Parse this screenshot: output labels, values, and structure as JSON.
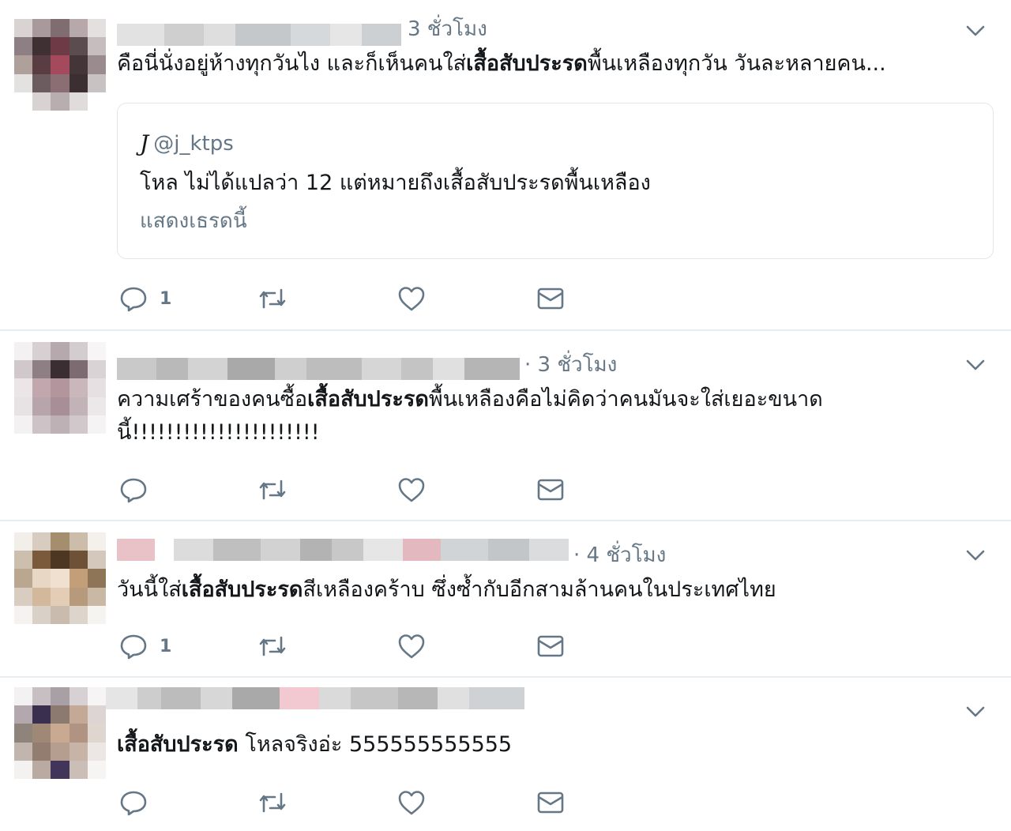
{
  "tweets": [
    {
      "timestamp": "3 ชั่วโมง",
      "text_before": "คือนี่นั่งอยู่ห้างทุกวันไง และก็เห็นคนใส่",
      "text_bold": "เสื้อสับประรด",
      "text_after": "พื้นเหลืองทุกวัน วันละหลายคน...",
      "quote": {
        "handle": "@j_ktps",
        "text": "โหล ไม่ได้แปลว่า 12 แต่หมายถึงเสื้อสับประรดพื้นเหลือง",
        "link": "แสดงเธรดนี้"
      },
      "reply_count": "1"
    },
    {
      "timestamp": "· 3 ชั่วโมง",
      "text_before": "ความเศร้าของคนซื้อ",
      "text_bold": "เสื้อสับประรด",
      "text_after": "พื้นเหลืองคือไม่คิดว่าคนมันจะใส่เยอะขนาด\nนี้!!!!!!!!!!!!!!!!!!!!!!",
      "reply_count": ""
    },
    {
      "timestamp": "· 4 ชั่วโมง",
      "text_before": "วันนี้ใส่",
      "text_bold": "เสื้อสับประรด",
      "text_after": "สีเหลืองคร้าบ ซึ่งซ้ำกับอีกสามล้านคนในประเทศไทย",
      "reply_count": "1"
    },
    {
      "timestamp": "",
      "text_before": "",
      "text_bold": "เสื้อสับประรด",
      "text_after": " โหลจริงอ่ะ 555555555555",
      "reply_count": ""
    }
  ],
  "icons": {
    "reply": "reply-icon",
    "retweet": "retweet-icon",
    "like": "heart-icon",
    "dm": "envelope-icon",
    "menu": "chevron-down-icon"
  },
  "colors": {
    "text": "#14171a",
    "muted": "#657786",
    "icon": "#657786",
    "border": "#e6ecf0"
  }
}
